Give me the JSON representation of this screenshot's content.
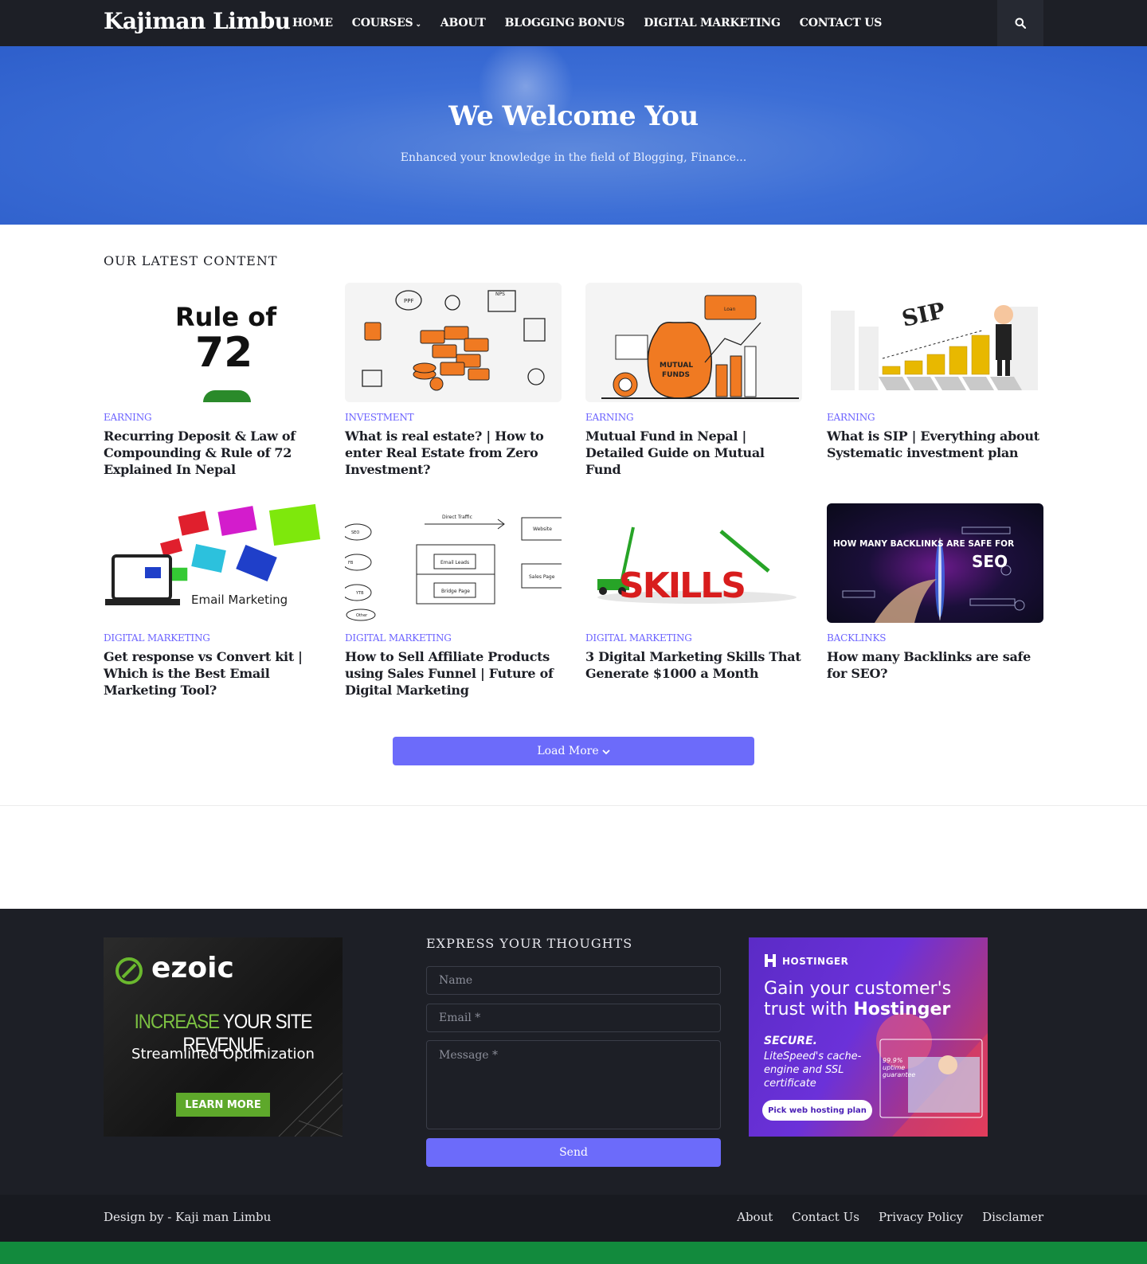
{
  "site": {
    "logo": "Kajiman Limbu"
  },
  "nav": {
    "items": [
      {
        "label": "HOME"
      },
      {
        "label": "COURSES",
        "has_dropdown": true
      },
      {
        "label": "ABOUT"
      },
      {
        "label": "BLOGGING BONUS"
      },
      {
        "label": "DIGITAL MARKETING"
      },
      {
        "label": "CONTACT US"
      }
    ],
    "search_icon": "search-icon"
  },
  "hero": {
    "title": "We Welcome You",
    "subtitle": "Enhanced your knowledge in the field of Blogging, Finance..."
  },
  "latest": {
    "heading": "OUR LATEST CONTENT",
    "posts": [
      {
        "category": "EARNING",
        "title": "Recurring Deposit & Law of Compounding & Rule of 72 Explained In Nepal",
        "thumb_text": [
          "Rule of",
          "72"
        ]
      },
      {
        "category": "INVESTMENT",
        "title": "What is real estate? | How to enter Real Estate from Zero Investment?",
        "thumb_text": [
          "PPF",
          "NPS"
        ]
      },
      {
        "category": "EARNING",
        "title": "Mutual Fund in Nepal | Detailed Guide on Mutual Fund",
        "thumb_text": [
          "MUTUAL",
          "FUNDS",
          "Loan"
        ]
      },
      {
        "category": "EARNING",
        "title": "What is SIP | Everything about Systematic investment plan",
        "thumb_text": [
          "SIP"
        ]
      },
      {
        "category": "DIGITAL MARKETING",
        "title": "Get response vs Convert kit | Which is the Best Email Marketing Tool?",
        "thumb_text": [
          "Email Marketing"
        ]
      },
      {
        "category": "DIGITAL MARKETING",
        "title": "How to Sell Affiliate Products using Sales Funnel | Future of Digital Marketing",
        "thumb_text": [
          "Direct Traffic",
          "Website",
          "SEO",
          "FB",
          "YTB",
          "Other",
          "Email Leads",
          "Bridge Page",
          "Sales Page"
        ]
      },
      {
        "category": "DIGITAL MARKETING",
        "title": "3 Digital Marketing Skills That Generate $1000 a Month",
        "thumb_text": [
          "SKILLS"
        ]
      },
      {
        "category": "BACKLINKS",
        "title": "How many Backlinks are safe for SEO?",
        "thumb_text": [
          "HOW MANY BACKLINKS ARE SAFE FOR",
          "SEO"
        ]
      }
    ],
    "load_more": "Load More"
  },
  "footer": {
    "ad_left": {
      "brand": "ezoic",
      "headline_a": "INCREASE",
      "headline_b": "YOUR SITE REVENUE",
      "sub": "Streamlined Optimization",
      "cta": "LEARN MORE"
    },
    "form": {
      "heading": "EXPRESS YOUR THOUGHTS",
      "name_placeholder": "Name",
      "email_placeholder": "Email *",
      "message_placeholder": "Message *",
      "send": "Send"
    },
    "ad_right": {
      "brand": "HOSTINGER",
      "headline": "Gain your customer's trust with",
      "headline_bold": "Hostinger",
      "secure": "SECURE.",
      "body": "LiteSpeed's cache-engine and SSL certificate",
      "uptime": "99.9% uptime guarantee",
      "cta": "Pick web hosting plan"
    },
    "credit": "Design by - Kaji man Limbu",
    "links": [
      "About",
      "Contact Us",
      "Privacy Policy",
      "Disclamer"
    ]
  },
  "colors": {
    "accent": "#6c6bfa",
    "dark": "#1d1f26",
    "hero_blue": "#3c6ed6",
    "category": "#6c63ff",
    "green_bar": "#128a3d"
  }
}
